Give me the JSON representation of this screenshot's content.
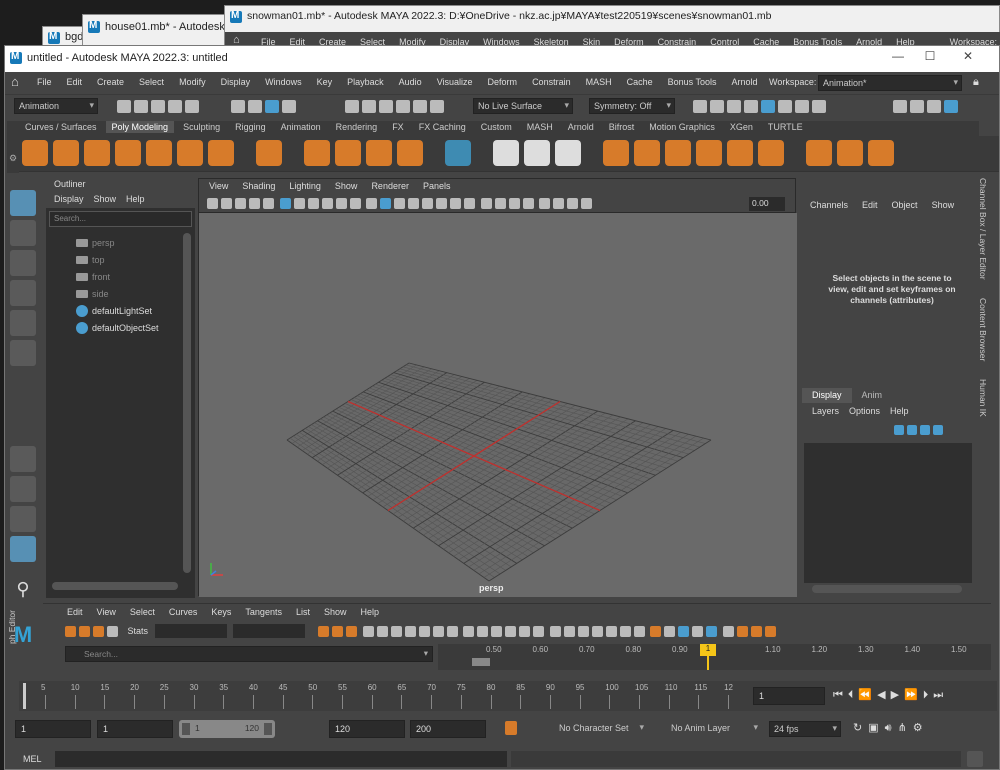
{
  "bg_windows": [
    {
      "title": "bgd"
    },
    {
      "title": "house01.mb* - Autodesk M"
    },
    {
      "title": "snowman01.mb* - Autodesk MAYA 2022.3: D:¥OneDrive - nkz.ac.jp¥MAYA¥test220519¥scenes¥snowman01.mb",
      "menu": [
        "File",
        "Edit",
        "Create",
        "Select",
        "Modify",
        "Display",
        "Windows",
        "Skeleton",
        "Skin",
        "Deform",
        "Constrain",
        "Control",
        "Cache",
        "Bonus Tools",
        "Arnold",
        "Help"
      ],
      "workspace": "Workspace:"
    }
  ],
  "window": {
    "title": "untitled - Autodesk MAYA 2022.3: untitled",
    "min": "—",
    "max": "☐",
    "close": "✕"
  },
  "main_menu": [
    "File",
    "Edit",
    "Create",
    "Select",
    "Modify",
    "Display",
    "Windows",
    "Key",
    "Playback",
    "Audio",
    "Visualize",
    "Deform",
    "Constrain",
    "MASH",
    "Cache",
    "Bonus Tools",
    "Arnold"
  ],
  "workspace": {
    "label": "Workspace:",
    "value": "Animation*"
  },
  "status_line": {
    "menuset": "Animation",
    "live_surface": "No Live Surface",
    "symmetry": "Symmetry: Off"
  },
  "shelf_tabs": [
    "Curves / Surfaces",
    "Poly Modeling",
    "Sculpting",
    "Rigging",
    "Animation",
    "Rendering",
    "FX",
    "FX Caching",
    "Custom",
    "MASH",
    "Arnold",
    "Bifrost",
    "Motion Graphics",
    "XGen",
    "TURTLE"
  ],
  "shelf_active": "Poly Modeling",
  "outliner": {
    "title": "Outliner",
    "menu": [
      "Display",
      "Show",
      "Help"
    ],
    "search_placeholder": "Search...",
    "items": [
      {
        "label": "persp"
      },
      {
        "label": "top"
      },
      {
        "label": "front"
      },
      {
        "label": "side"
      },
      {
        "label": "defaultLightSet"
      },
      {
        "label": "defaultObjectSet"
      }
    ]
  },
  "viewport": {
    "menu": [
      "View",
      "Shading",
      "Lighting",
      "Show",
      "Renderer",
      "Panels"
    ],
    "exposure": "0.00",
    "camera_label": "persp"
  },
  "channel_box": {
    "menu": [
      "Channels",
      "Edit",
      "Object",
      "Show"
    ],
    "message": "Select objects in the scene to view, edit and set keyframes on channels (attributes)"
  },
  "layer_editor": {
    "tabs": [
      "Display",
      "Anim"
    ],
    "menu": [
      "Layers",
      "Options",
      "Help"
    ]
  },
  "side_tabs": [
    "Channel Box / Layer Editor",
    "Content Browser",
    "Human IK"
  ],
  "graph_editor": {
    "side_label": "ph Editor",
    "menu": [
      "Edit",
      "View",
      "Select",
      "Curves",
      "Keys",
      "Tangents",
      "List",
      "Show",
      "Help"
    ],
    "stats_label": "Stats",
    "search_placeholder": "Search...",
    "ruler": [
      "0.50",
      "0.60",
      "0.70",
      "0.80",
      "0.90",
      "1",
      "1.10",
      "1.20",
      "1.30",
      "1.40",
      "1.50"
    ]
  },
  "time_slider": {
    "ticks": [
      "5",
      "10",
      "15",
      "20",
      "25",
      "30",
      "35",
      "40",
      "45",
      "50",
      "55",
      "60",
      "65",
      "70",
      "75",
      "80",
      "85",
      "90",
      "95",
      "100",
      "105",
      "110",
      "115",
      "12"
    ],
    "current_frame": "1"
  },
  "range": {
    "start": "1",
    "playback_start": "1",
    "slider_start": "1",
    "slider_end": "120",
    "playback_end": "120",
    "end": "200",
    "character_set": "No Character Set",
    "anim_layer": "No Anim Layer",
    "fps": "24 fps"
  },
  "command_line": {
    "label": "MEL"
  },
  "colors": {
    "accent": "#5790b4",
    "shelf_orange": "#d77b2a",
    "grid_axis": "#c0312e",
    "viewport_bg": "#6a6a6a"
  }
}
